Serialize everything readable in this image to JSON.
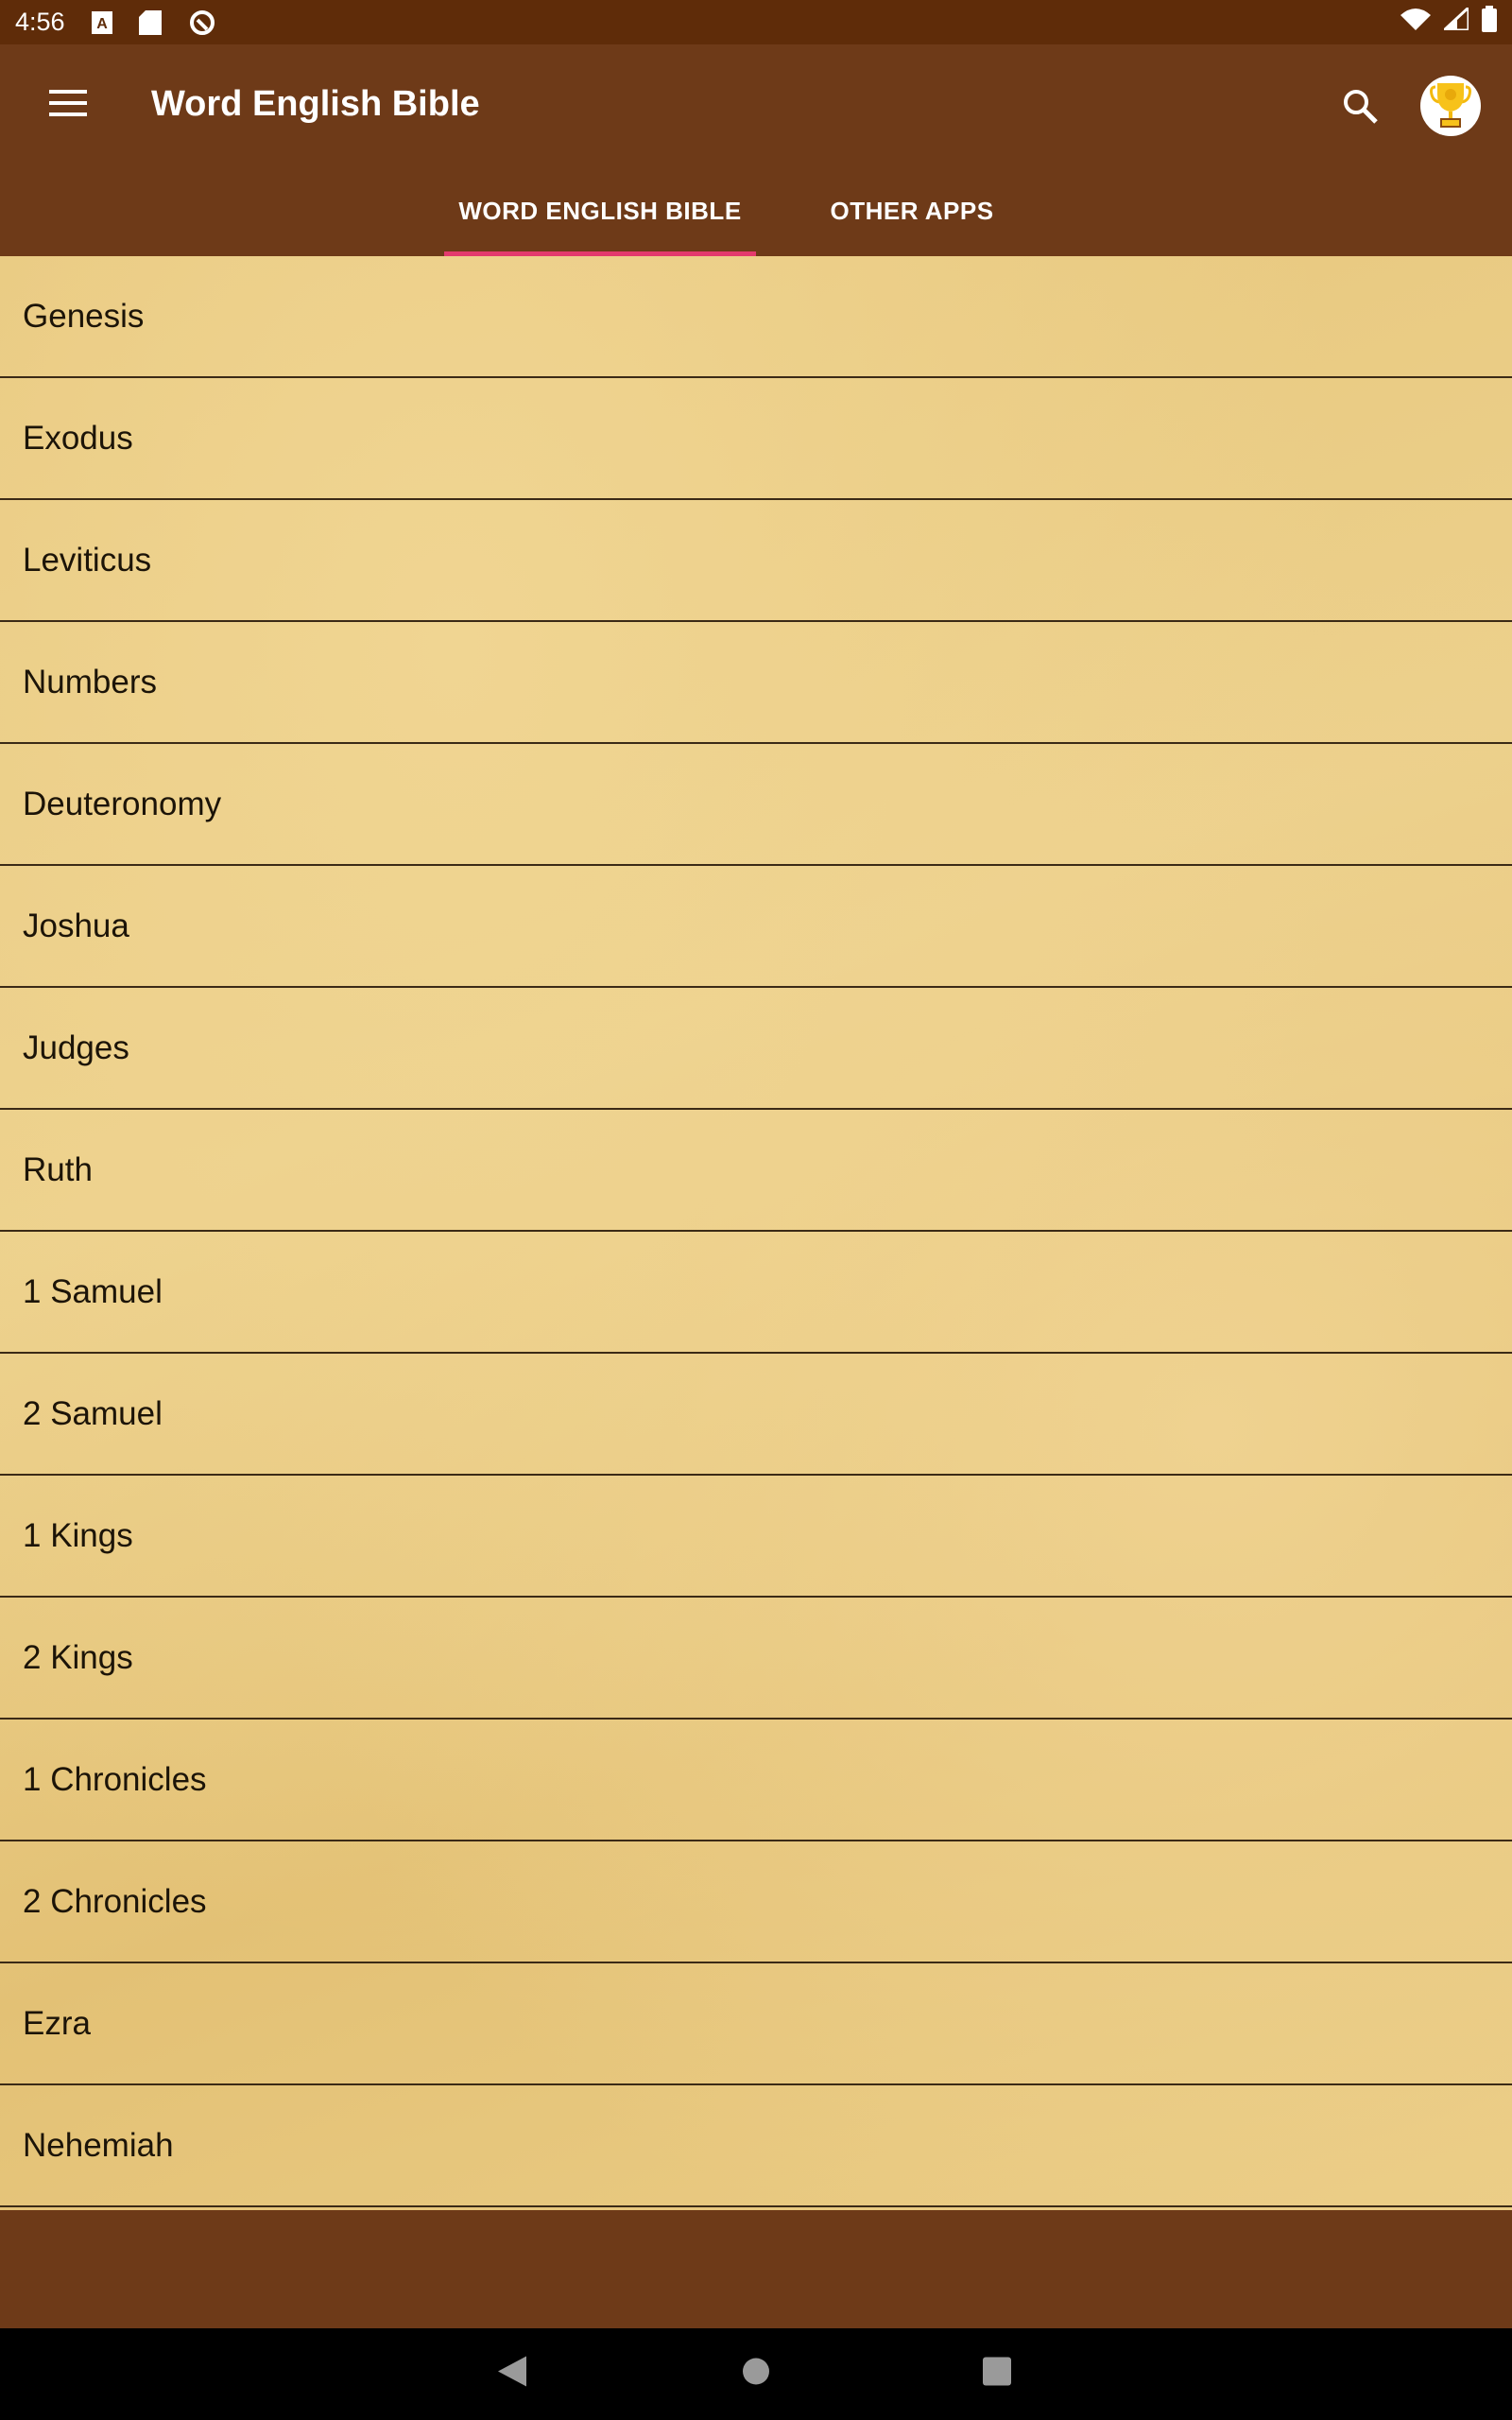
{
  "status_bar": {
    "time": "4:56",
    "icons": [
      "a-notification-icon",
      "sd-card-icon",
      "sync-icon",
      "wifi-icon",
      "signal-icon",
      "battery-icon"
    ]
  },
  "app_bar": {
    "title": "Word English Bible",
    "icons": [
      "menu-icon",
      "search-icon",
      "trophy-icon"
    ]
  },
  "tabs": [
    {
      "label": "WORD ENGLISH BIBLE",
      "active": true
    },
    {
      "label": "OTHER APPS",
      "active": false
    }
  ],
  "books": [
    "Genesis",
    "Exodus",
    "Leviticus",
    "Numbers",
    "Deuteronomy",
    "Joshua",
    "Judges",
    "Ruth",
    "1 Samuel",
    "2 Samuel",
    "1 Kings",
    "2 Kings",
    "1 Chronicles",
    "2 Chronicles",
    "Ezra",
    "Nehemiah"
  ],
  "colors": {
    "status_bar": "#5f2c09",
    "app_bar": "#6e3a18",
    "tab_indicator": "#e33a6d",
    "parchment": "#e8c97f"
  }
}
